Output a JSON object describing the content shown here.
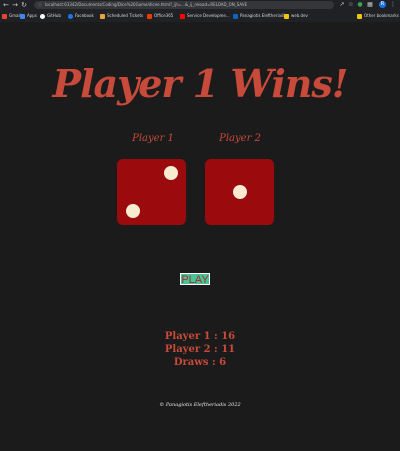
{
  "browser": {
    "url": "localhost:63342/Documents/Coding/Dice%20Game/dicee.html?_ijt=...&_ij_reload=RELOAD_ON_SAVE",
    "url_host": "localhost",
    "profile_initial": "R",
    "bookmarks": [
      {
        "label": "Gmail",
        "color": "#ea4335"
      },
      {
        "label": "Apps",
        "color": "#4285f4"
      },
      {
        "label": "GitHub",
        "color": "#ffffff"
      },
      {
        "label": "Facebook",
        "color": "#1877f2"
      },
      {
        "label": "Scheduled Tickets",
        "color": "#e8a33d"
      },
      {
        "label": "Office365",
        "color": "#eb3c00"
      },
      {
        "label": "Service Developme...",
        "color": "#ff0000"
      },
      {
        "label": "Panagiotis Eleftheriadi...",
        "color": "#0a66c2"
      },
      {
        "label": "web.dev",
        "color": "#f1c40f"
      }
    ],
    "other_bookmarks": "Other bookmarks"
  },
  "game": {
    "title": "Player 1 Wins!",
    "players": [
      {
        "label": "Player 1",
        "dice_value": 2
      },
      {
        "label": "Player 2",
        "dice_value": 1
      }
    ],
    "play_label": "PLAY",
    "scores": [
      "Player 1 : 16",
      "Player 2 : 11",
      "Draws : 6"
    ],
    "footer": "© Panagiotis Eleftheriadis 2022"
  },
  "colors": {
    "background": "#1b1b1b",
    "accent": "#c84a3a",
    "dice": "#9b0a0d",
    "pip": "#f7ebd0",
    "button": "#46c59a"
  }
}
